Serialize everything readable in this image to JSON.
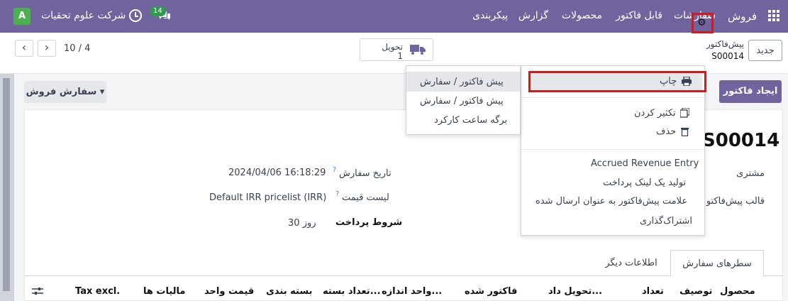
{
  "navbar": {
    "brand": "فروش",
    "menu": [
      "سفارشات",
      "قابل فاکتور",
      "محصولات",
      "گزارش",
      "پیکربندی"
    ],
    "company": "شرکت علوم تحقیات",
    "avatar": "A",
    "chat_badge": "14",
    "color": "#71639e"
  },
  "control": {
    "new_button": "جدید",
    "breadcrumb_parent": "پیش‌فاکتور",
    "breadcrumb_current": "S00014",
    "smart_delivery_label": "تحویل",
    "smart_delivery_value": "1",
    "pager": "10 / 4",
    "prev": "‹",
    "next": "›"
  },
  "actions": {
    "create_invoice": "ایجاد فاکتور",
    "sale_order": "سفارش فروش ▾"
  },
  "form": {
    "title": "S00014",
    "customer_label": "مشتری",
    "template_label": "قالب پیش‌فاکتو",
    "order_date_label": "تاریخ سفارش",
    "order_date_value": "2024/04/06 16:18:29",
    "pricelist_label": "لیست قیمت",
    "pricelist_value": "Default IRR pricelist (IRR)",
    "payment_terms_label": "شروط پرداخت",
    "payment_terms_value": "30 روز",
    "help_mark": "?"
  },
  "tabs": {
    "order_lines": "سطرهای سفارش",
    "other_info": "اطلاعات دیگر"
  },
  "columns": [
    "محصول",
    "توصیف",
    "تعداد",
    "تحویل داد...",
    "فاکتور شده",
    "واحد اندازه...",
    "تعداد بسته...",
    "بسته بندی",
    "قیمت واحد",
    "مالیات ها",
    "Tax excl."
  ],
  "gear_menu": {
    "print": "چاپ",
    "duplicate": "تکثیر کردن",
    "delete": "حذف",
    "accrued": "Accrued Revenue Entry",
    "payment_link": "تولید یک لینک پرداخت",
    "mark_sent": "علامت پیش‌فاکتور به عنوان ارسال شده",
    "share": "اشتراک‌گذاری"
  },
  "print_submenu": [
    "پیش فاکتور / سفارش",
    "پیش فاکتور / سفارش",
    "برگه ساعت کارکرد"
  ]
}
